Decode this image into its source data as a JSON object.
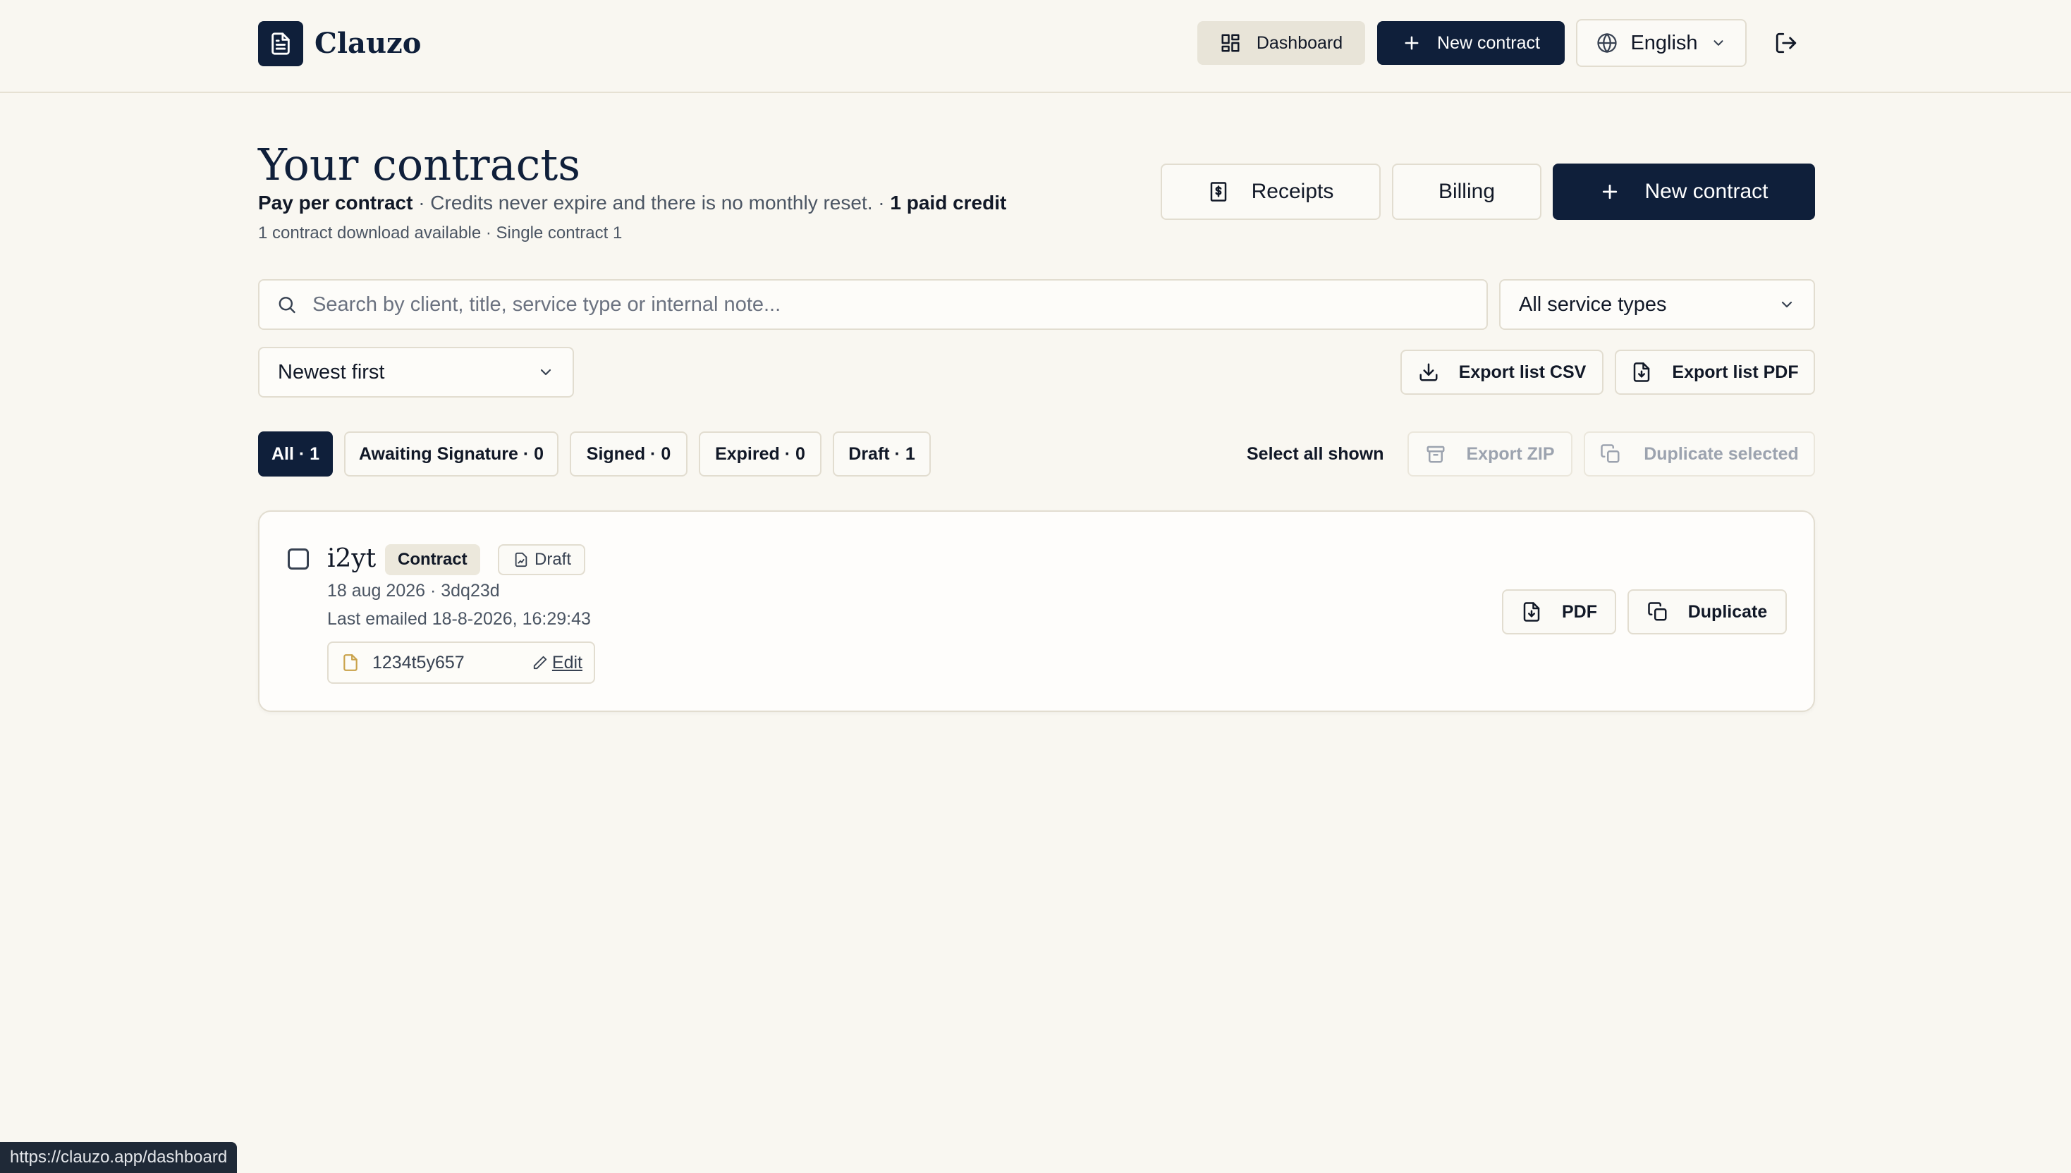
{
  "header": {
    "logo": "Clauzo",
    "dashboard_label": "Dashboard",
    "new_contract_label": "New contract",
    "language": "English"
  },
  "page": {
    "title": "Your contracts",
    "plan_name": "Pay per contract",
    "plan_description": " · Credits never expire and there is no monthly reset. · ",
    "credits": "1 paid credit",
    "downloads_info": "1 contract download available · Single contract 1",
    "receipts_label": "Receipts",
    "billing_label": "Billing",
    "new_contract_label": "New contract"
  },
  "filters": {
    "search_placeholder": "Search by client, title, service type or internal note...",
    "service_type": "All service types",
    "sort": "Newest first",
    "export_csv": "Export list CSV",
    "export_pdf": "Export list PDF"
  },
  "tabs": [
    {
      "label": "All · 1",
      "active": true
    },
    {
      "label": "Awaiting Signature · 0",
      "active": false
    },
    {
      "label": "Signed · 0",
      "active": false
    },
    {
      "label": "Expired · 0",
      "active": false
    },
    {
      "label": "Draft · 1",
      "active": false
    }
  ],
  "bulk": {
    "select_all": "Select all shown",
    "export_zip": "Export ZIP",
    "duplicate_selected": "Duplicate selected"
  },
  "contracts": [
    {
      "title": "i2yt",
      "type_badge": "Contract",
      "status_badge": "Draft",
      "meta": "18 aug 2026 · 3dq23d",
      "last_emailed": "Last emailed 18-8-2026, 16:29:43",
      "note": "1234t5y657",
      "edit_label": "Edit",
      "pdf_label": "PDF",
      "duplicate_label": "Duplicate"
    }
  ],
  "statusbar": {
    "url": "https://clauzo.app/dashboard"
  },
  "colors": {
    "background": "#f9f7f1",
    "primary": "#0f1f3a",
    "border": "#e2ddd0",
    "note_icon": "#c9a24a"
  },
  "icons": {
    "logo": "document-icon",
    "dashboard": "grid-icon",
    "language": "globe-icon",
    "logout": "logout-icon",
    "receipts": "receipt-icon",
    "search": "search-icon",
    "export_csv": "download-icon",
    "export_pdf": "file-download-icon",
    "export_zip": "archive-icon",
    "duplicate": "copy-icon",
    "note": "file-icon",
    "edit": "pencil-icon"
  }
}
